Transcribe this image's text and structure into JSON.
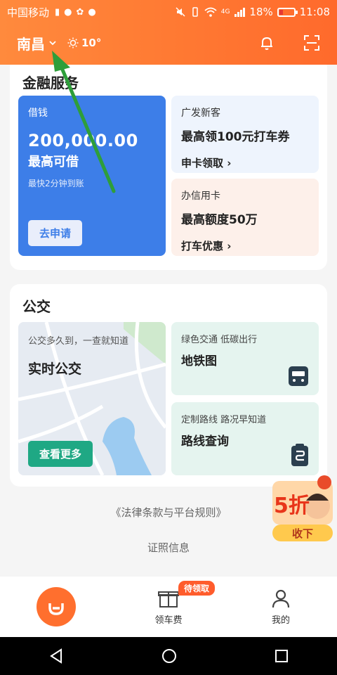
{
  "status_bar": {
    "carrier": "中国移动",
    "battery": "18%",
    "time": "11:08",
    "network": "4G"
  },
  "header": {
    "city": "南昌",
    "temperature": "10°",
    "icons": [
      "chevron-down-icon",
      "sun-icon",
      "bell-icon",
      "scan-icon"
    ]
  },
  "finance": {
    "title": "金融服务",
    "loan": {
      "label": "借钱",
      "amount": "200,000.00",
      "subtitle": "最高可借",
      "note": "最快2分钟到账",
      "button": "去申请"
    },
    "card1": {
      "label": "广发新客",
      "title": "最高领100元打车券",
      "action": "申卡领取 ›"
    },
    "card2": {
      "label": "办信用卡",
      "title": "最高额度50万",
      "action": "打车优惠 ›"
    }
  },
  "bus": {
    "title": "公交",
    "realtime": {
      "hint": "公交多久到，一查就知道",
      "title": "实时公交",
      "button": "查看更多"
    },
    "subway": {
      "hint": "绿色交通 低碳出行",
      "title": "地铁图"
    },
    "route": {
      "hint": "定制路线 路况早知道",
      "title": "路线查询"
    }
  },
  "footer": {
    "legal": "《法律条款与平台规则》",
    "license": "证照信息"
  },
  "promo": {
    "discount": "5折",
    "button": "收下"
  },
  "bottom_nav": {
    "badge": "待领取",
    "items": [
      {
        "label": ""
      },
      {
        "label": "领车费"
      },
      {
        "label": "我的"
      }
    ]
  },
  "colors": {
    "brand_orange": "#ff7a33",
    "loan_blue": "#3d7ee8",
    "bus_green": "#1fa884"
  }
}
